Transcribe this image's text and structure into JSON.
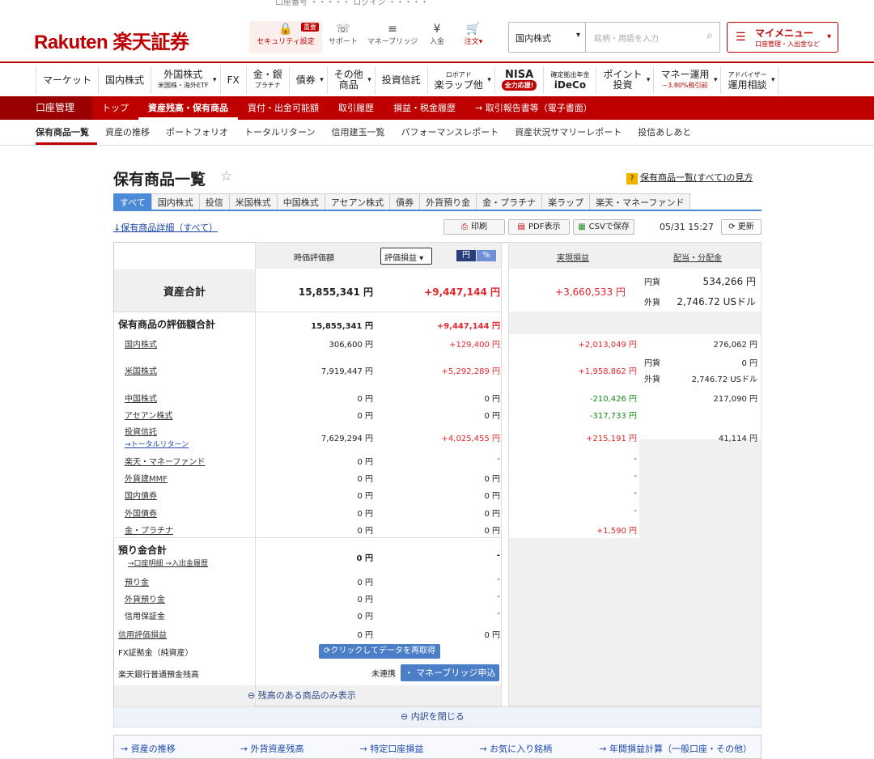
{
  "header": {
    "topcut": "口座番号 ・・・・・ ログイン ・・・・・",
    "logo": "Rakuten 楽天証券",
    "icons": [
      {
        "g": "🔒",
        "label": "セキュリティ設定",
        "badge": "重要"
      },
      {
        "g": "☏",
        "label": "サポート"
      },
      {
        "g": "≡",
        "label": "マネーブリッジ"
      },
      {
        "g": "¥",
        "label": "入金"
      },
      {
        "g": "🛒",
        "label": "注文▾"
      }
    ],
    "search": {
      "select": "国内株式",
      "placeholder": "銘柄・用語を入力"
    },
    "mymenu": {
      "title": "マイメニュー",
      "sub": "口座管理・入出金など"
    }
  },
  "nav": [
    {
      "t": "マーケット"
    },
    {
      "t": "国内株式"
    },
    {
      "t": "外国株式",
      "s": "米国株・海外ETF"
    },
    {
      "t": "FX"
    },
    {
      "t": "金・銀",
      "s": "プラチナ"
    },
    {
      "t": "債券"
    },
    {
      "t": "その他",
      "s": "商品"
    },
    {
      "t": "投資信託"
    },
    {
      "t": "ロボアド",
      "s": "楽ラップ他"
    },
    {
      "t": "NISA",
      "s": "全力応援!"
    },
    {
      "t": "確定拠出年金",
      "s": "iDeCo"
    },
    {
      "t": "ポイント",
      "s": "投資"
    },
    {
      "t": "マネー運用",
      "s": "~3.80%税引前"
    },
    {
      "t": "アドバイザー",
      "s": "運用相談"
    }
  ],
  "redbar": {
    "account": "口座管理",
    "items": [
      "トップ",
      "資産残高・保有商品",
      "買付・出金可能額",
      "取引履歴",
      "損益・税金履歴",
      "→ 取引報告書等（電子書面）"
    ]
  },
  "subnav": [
    "保有商品一覧",
    "資産の推移",
    "ポートフォリオ",
    "トータルリターン",
    "信用建玉一覧",
    "パフォーマンスレポート",
    "資産状況サマリーレポート",
    "投信あしあと"
  ],
  "page": {
    "title": "保有商品一覧",
    "help": "保有商品一覧(すべて)の見方",
    "detail": "↓保有商品詳細（すべて）",
    "print": "印刷",
    "pdf": "PDF表示",
    "csv": "CSVで保存",
    "time": "05/31 15:27",
    "update": "更新"
  },
  "tabs": [
    "すべて",
    "国内株式",
    "投信",
    "米国株式",
    "中国株式",
    "アセアン株式",
    "債券",
    "外貨預り金",
    "金・プラチナ",
    "楽ラップ",
    "楽天・マネーファンド"
  ],
  "table": {
    "h_value": "時価評価額",
    "h_select": "評価損益",
    "h_yen": "円",
    "h_pct": "%",
    "h_realized": "実現損益",
    "h_div": "配当・分配金",
    "total": {
      "label": "資産合計",
      "value": "15,855,341 円",
      "gain": "+9,447,144 円",
      "realized": "+3,660,533 円",
      "div_yen_l": "円貨",
      "div_yen": "534,266 円",
      "div_fx_l": "外貨",
      "div_fx": "2,746.72 USドル"
    },
    "sub": {
      "label": "保有商品の評価額合計",
      "value": "15,855,341 円",
      "gain": "+9,447,144 円"
    },
    "rows": [
      {
        "label": "国内株式",
        "value": "306,600 円",
        "gain": "+129,400 円",
        "realized": "+2,013,049 円",
        "div": "276,062 円"
      },
      {
        "label": "米国株式",
        "value": "7,919,447 円",
        "gain": "+5,292,289 円",
        "realized": "+1,958,862 円",
        "div_yen_l": "円貨",
        "div_yen": "0 円",
        "div_fx_l": "外貨",
        "div_fx": "2,746.72 USドル"
      },
      {
        "label": "中国株式",
        "value": "0 円",
        "gain": "0 円",
        "realized": "-210,426 円",
        "div": "217,090 円"
      },
      {
        "label": "アセアン株式",
        "value": "0 円",
        "gain": "0 円",
        "realized": "-317,733 円",
        "div": ""
      },
      {
        "label": "投資信託",
        "sub": "→トータルリターン",
        "value": "7,629,294 円",
        "gain": "+4,025,455 円",
        "realized": "+215,191 円",
        "div": "41,114 円"
      },
      {
        "label": "楽天・マネーファンド",
        "value": "0 円",
        "gain": "-",
        "realized": "-"
      },
      {
        "label": "外貨建MMF",
        "value": "0 円",
        "gain": "0 円",
        "realized": "-"
      },
      {
        "label": "国内債券",
        "value": "0 円",
        "gain": "0 円",
        "realized": "-"
      },
      {
        "label": "外国債券",
        "value": "0 円",
        "gain": "0 円",
        "realized": "-"
      },
      {
        "label": "金・プラチナ",
        "value": "0 円",
        "gain": "0 円",
        "realized": "+1,590 円"
      }
    ],
    "deposit": {
      "label": "預り金合計",
      "links": "→口座明細 →入出金履歴",
      "value": "0 円",
      "gain": "-"
    },
    "deprows": [
      {
        "label": "預り金",
        "value": "0 円",
        "gain": "-"
      },
      {
        "label": "外貨預り金",
        "value": "0 円",
        "gain": "-"
      },
      {
        "label": "信用保証金",
        "value": "0 円",
        "gain": "-"
      }
    ],
    "credit": {
      "label": "信用評価損益",
      "value": "0 円",
      "gain": "0 円"
    },
    "fx": {
      "label": "FX証拠金（純資産）",
      "button": "クリックしてデータを再取得"
    },
    "bank": {
      "label": "楽天銀行普通預金残高",
      "status": "未連携",
      "button": "・ マネーブリッジ申込"
    },
    "only": "残高のある商品のみ表示",
    "close": "内訳を閉じる"
  },
  "footer": [
    "→ 資産の推移",
    "→ 外貨資産残高",
    "→ 特定口座損益",
    "→ お気に入り銘柄",
    "→ 年間損益計算（一般口座・その他）"
  ]
}
